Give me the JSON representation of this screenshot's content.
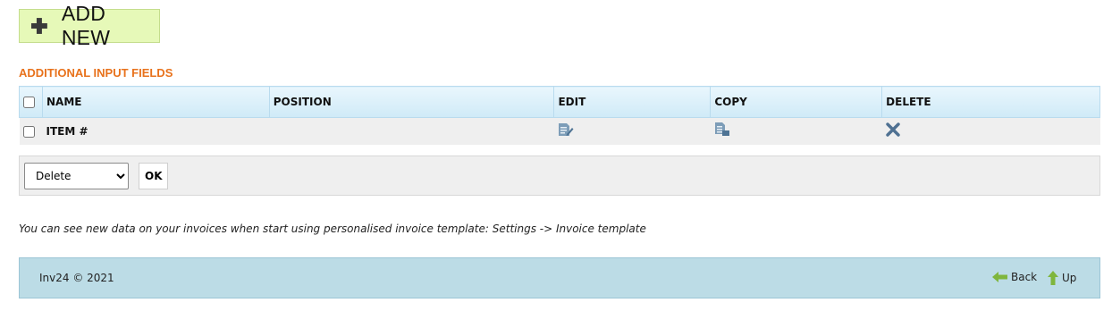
{
  "toolbar": {
    "add_label": "ADD NEW"
  },
  "section": {
    "title": "ADDITIONAL INPUT FIELDS"
  },
  "table": {
    "headers": [
      "NAME",
      "POSITION",
      "EDIT",
      "COPY",
      "DELETE"
    ],
    "rows": [
      {
        "name": "ITEM #",
        "position": ""
      }
    ]
  },
  "bulk": {
    "selected": "Delete",
    "ok_label": "OK"
  },
  "note": "You can see new data on your invoices when start using personalised invoice template: Settings -> Invoice template",
  "footer": {
    "copyright": "Inv24 © 2021",
    "back_label": "Back",
    "up_label": "Up"
  },
  "icons": {
    "add": "plus-icon",
    "edit": "edit-icon",
    "copy": "copy-icon",
    "delete": "delete-icon",
    "back": "arrow-left-icon",
    "up": "arrow-up-icon"
  },
  "colors": {
    "add_bg": "#e6f9b8",
    "section_title": "#e8721c",
    "header_bg": "#d8eef9",
    "footer_bg": "#bcdce6",
    "icon_blue": "#5f86a6",
    "arrow_green": "#7fb63d"
  }
}
